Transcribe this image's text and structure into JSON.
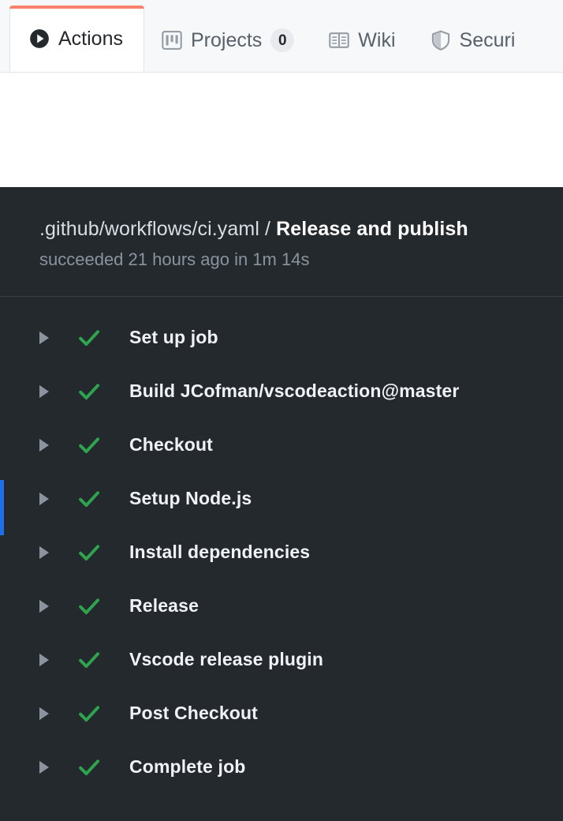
{
  "tabs": [
    {
      "label": "Actions",
      "icon": "play-icon",
      "active": true,
      "count": null
    },
    {
      "label": "Projects",
      "icon": "project-icon",
      "active": false,
      "count": "0"
    },
    {
      "label": "Wiki",
      "icon": "book-icon",
      "active": false,
      "count": null
    },
    {
      "label": "Securi",
      "icon": "shield-icon",
      "active": false,
      "count": null
    }
  ],
  "log": {
    "workflow_path": ".github/workflows/ci.yaml",
    "separator": "/",
    "job_name": "Release and publish",
    "status_line": "succeeded 21 hours ago in 1m 14s",
    "steps": [
      {
        "name": "Set up job",
        "status": "success"
      },
      {
        "name": "Build JCofman/vscodeaction@master",
        "status": "success"
      },
      {
        "name": "Checkout",
        "status": "success"
      },
      {
        "name": "Setup Node.js",
        "status": "success"
      },
      {
        "name": "Install dependencies",
        "status": "success"
      },
      {
        "name": "Release",
        "status": "success"
      },
      {
        "name": "Vscode release plugin",
        "status": "success"
      },
      {
        "name": "Post Checkout",
        "status": "success"
      },
      {
        "name": "Complete job",
        "status": "success"
      }
    ]
  },
  "colors": {
    "accent_orange": "#f9826c",
    "success_green": "#2ea44f",
    "panel_bg": "#24292e",
    "scroll_blue": "#1f6feb",
    "caret_gray": "#8b949e"
  }
}
